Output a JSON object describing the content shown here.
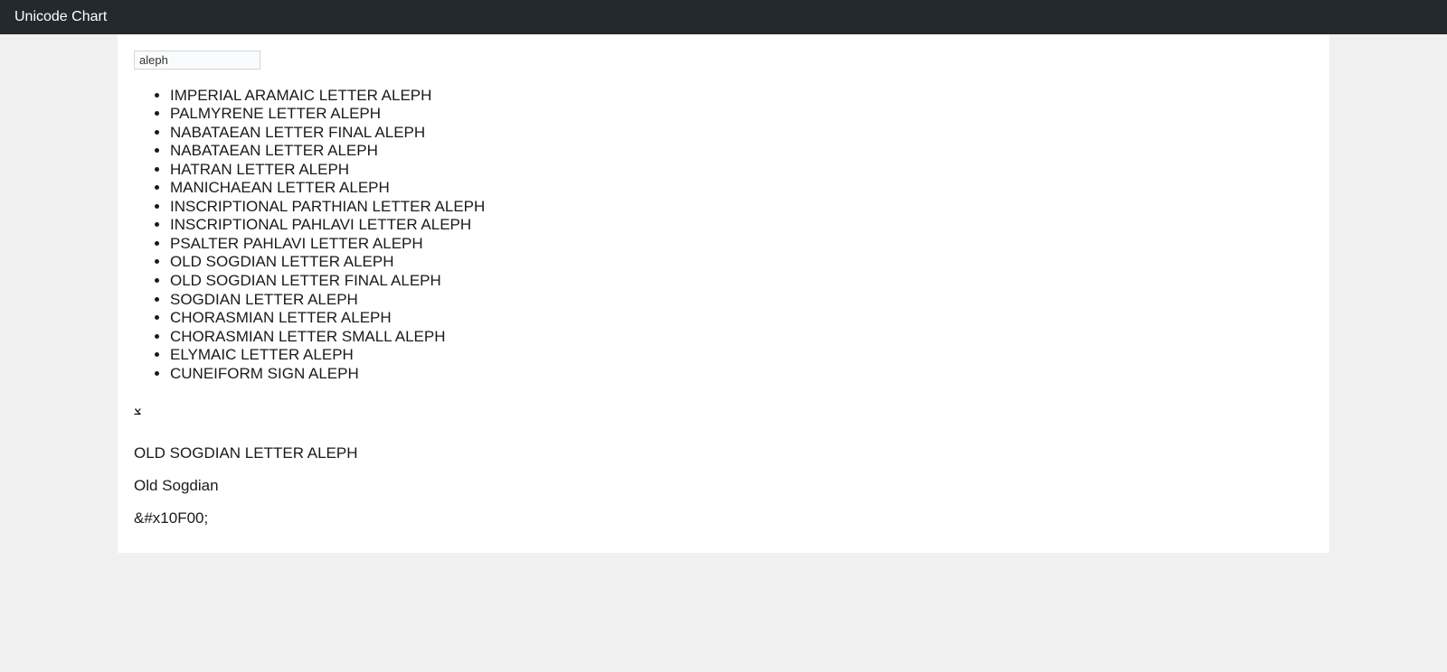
{
  "header": {
    "title": "Unicode Chart"
  },
  "search": {
    "value": "aleph"
  },
  "results": [
    "IMPERIAL ARAMAIC LETTER ALEPH",
    "PALMYRENE LETTER ALEPH",
    "NABATAEAN LETTER FINAL ALEPH",
    "NABATAEAN LETTER ALEPH",
    "HATRAN LETTER ALEPH",
    "MANICHAEAN LETTER ALEPH",
    "INSCRIPTIONAL PARTHIAN LETTER ALEPH",
    "INSCRIPTIONAL PAHLAVI LETTER ALEPH",
    "PSALTER PAHLAVI LETTER ALEPH",
    "OLD SOGDIAN LETTER ALEPH",
    "OLD SOGDIAN LETTER FINAL ALEPH",
    "SOGDIAN LETTER ALEPH",
    "CHORASMIAN LETTER ALEPH",
    "CHORASMIAN LETTER SMALL ALEPH",
    "ELYMAIC LETTER ALEPH",
    "CUNEIFORM SIGN ALEPH"
  ],
  "detail": {
    "glyph": "𐼀",
    "name": "OLD SOGDIAN LETTER ALEPH",
    "block": "Old Sogdian",
    "entity": "&#x10F00;"
  }
}
